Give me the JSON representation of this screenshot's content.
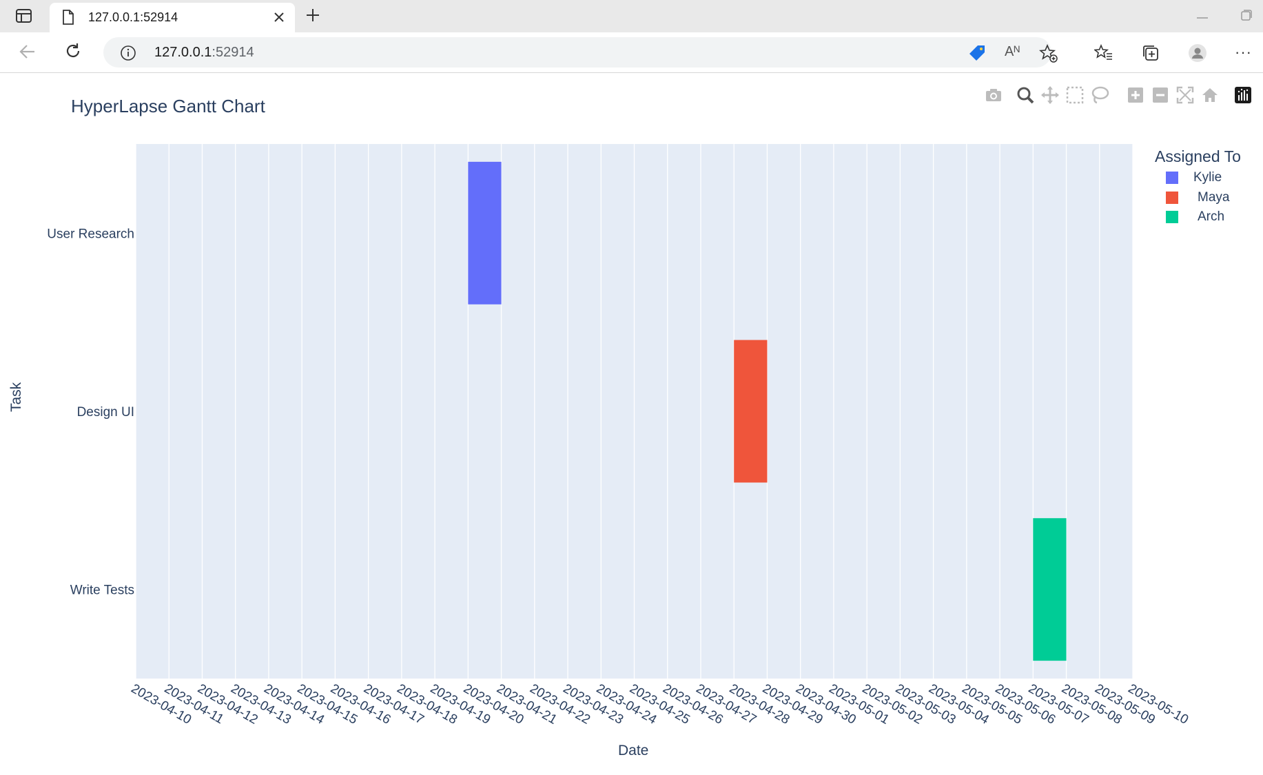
{
  "browser": {
    "tab_title": "127.0.0.1:52914",
    "url_host": "127.0.0.1",
    "url_port": ":52914",
    "icons": {
      "tab_actions": "tab-actions-icon",
      "page": "page-icon",
      "close": "close-icon",
      "new_tab": "plus-icon",
      "back": "back-arrow-icon",
      "reload": "reload-icon",
      "info": "info-icon",
      "tag": "price-tag-icon",
      "read_aloud": "read-aloud-icon",
      "add_favorite": "star-plus-icon",
      "favorites": "favorites-icon",
      "collections": "collections-icon",
      "profile": "profile-icon",
      "more": "more-icon"
    },
    "read_aloud_glyph": "Aᴺ",
    "more_glyph": "···"
  },
  "modebar": [
    "camera-icon",
    "zoom-icon",
    "pan-icon",
    "box-select-icon",
    "lasso-icon",
    "zoom-in-icon",
    "zoom-out-icon",
    "autoscale-icon",
    "reset-axes-icon",
    "plotly-logo-icon"
  ],
  "chart_data": {
    "type": "bar",
    "orientation": "horizontal-gantt",
    "title": "HyperLapse Gantt Chart",
    "xlabel": "Date",
    "ylabel": "Task",
    "legend_title": "Assigned To",
    "legend_position": "top-right",
    "grid": true,
    "xlim": [
      "2023-04-10",
      "2023-05-10"
    ],
    "x_ticks": [
      "2023-04-10",
      "2023-04-11",
      "2023-04-12",
      "2023-04-13",
      "2023-04-14",
      "2023-04-15",
      "2023-04-16",
      "2023-04-17",
      "2023-04-18",
      "2023-04-19",
      "2023-04-20",
      "2023-04-21",
      "2023-04-22",
      "2023-04-23",
      "2023-04-24",
      "2023-04-25",
      "2023-04-26",
      "2023-04-27",
      "2023-04-28",
      "2023-04-29",
      "2023-04-30",
      "2023-05-01",
      "2023-05-02",
      "2023-05-03",
      "2023-05-04",
      "2023-05-05",
      "2023-05-06",
      "2023-05-07",
      "2023-05-08",
      "2023-05-09",
      "2023-05-10"
    ],
    "categories": [
      "User Research",
      "Design UI",
      "Write Tests"
    ],
    "series": [
      {
        "name": "Kylie",
        "color": "#636efa",
        "task": "User Research",
        "start": "2023-04-20",
        "end": "2023-04-21"
      },
      {
        "name": "Maya",
        "color": "#ef553b",
        "task": "Design UI",
        "start": "2023-04-28",
        "end": "2023-04-29"
      },
      {
        "name": "Arch",
        "color": "#00cc96",
        "task": "Write Tests",
        "start": "2023-05-07",
        "end": "2023-05-08"
      }
    ],
    "plot_bg": "#e5ecf6",
    "text_color": "#2a3f5f"
  }
}
